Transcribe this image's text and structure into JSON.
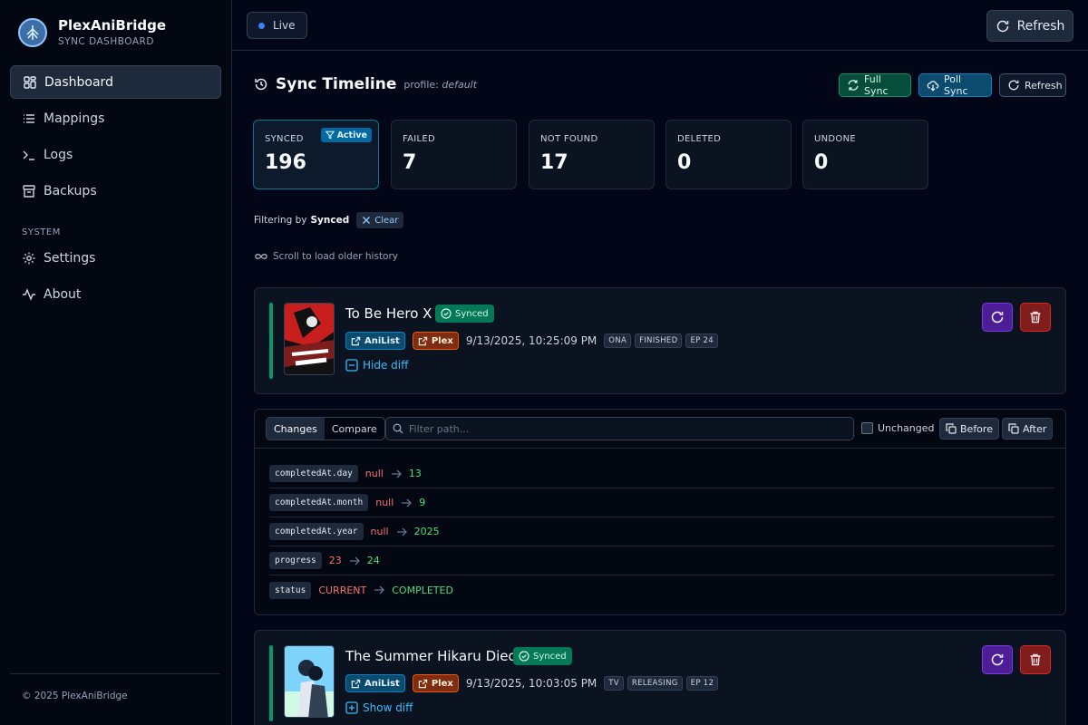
{
  "brand": {
    "name": "PlexAniBridge",
    "subtitle": "SYNC DASHBOARD"
  },
  "sidebar": {
    "items": [
      {
        "label": "Dashboard",
        "icon": "grid-icon",
        "active": true
      },
      {
        "label": "Mappings",
        "icon": "list-icon"
      },
      {
        "label": "Logs",
        "icon": "terminal-icon"
      },
      {
        "label": "Backups",
        "icon": "archive-icon"
      }
    ],
    "section_label": "SYSTEM",
    "system_items": [
      {
        "label": "Settings",
        "icon": "gear-icon"
      },
      {
        "label": "About",
        "icon": "activity-icon"
      }
    ],
    "copyright": "© 2025 PlexAniBridge"
  },
  "topbar": {
    "status": "Live",
    "refresh_label": "Refresh"
  },
  "timeline": {
    "title": "Sync Timeline",
    "profile_prefix": "profile:",
    "profile_name": "default",
    "buttons": {
      "full_sync": "Full Sync",
      "poll_sync": "Poll Sync",
      "refresh": "Refresh"
    },
    "stats": [
      {
        "label": "SYNCED",
        "value": "196",
        "active": true
      },
      {
        "label": "FAILED",
        "value": "7"
      },
      {
        "label": "NOT FOUND",
        "value": "17"
      },
      {
        "label": "DELETED",
        "value": "0"
      },
      {
        "label": "UNDONE",
        "value": "0"
      }
    ],
    "active_badge": "Active",
    "filter_prefix": "Filtering by",
    "filter_value": "Synced",
    "clear_label": "Clear",
    "scroll_hint": "Scroll to load older history"
  },
  "items": [
    {
      "title": "To Be Hero X",
      "status": "Synced",
      "anilist_label": "AniList",
      "plex_label": "Plex",
      "timestamp": "9/13/2025, 10:25:09 PM",
      "tags": [
        "ONA",
        "FINISHED",
        "EP 24"
      ],
      "diff_toggle": "Hide diff"
    },
    {
      "title": "The Summer Hikaru Died",
      "status": "Synced",
      "anilist_label": "AniList",
      "plex_label": "Plex",
      "timestamp": "9/13/2025, 10:03:05 PM",
      "tags": [
        "TV",
        "RELEASING",
        "EP 12"
      ],
      "diff_toggle": "Show diff"
    }
  ],
  "diff": {
    "tabs": [
      "Changes",
      "Compare"
    ],
    "filter_placeholder": "Filter path...",
    "unchanged_label": "Unchanged",
    "before_label": "Before",
    "after_label": "After",
    "rows": [
      {
        "path": "completedAt.day",
        "old": "null",
        "new": "13"
      },
      {
        "path": "completedAt.month",
        "old": "null",
        "new": "9"
      },
      {
        "path": "completedAt.year",
        "old": "null",
        "new": "2025"
      },
      {
        "path": "progress",
        "old": "23",
        "new": "24"
      },
      {
        "path": "status",
        "old": "CURRENT",
        "new": "COMPLETED"
      }
    ]
  },
  "colors": {
    "accent": "#3b82f6",
    "synced": "#047857",
    "old_value": "#f87171",
    "new_value": "#4ade80"
  }
}
